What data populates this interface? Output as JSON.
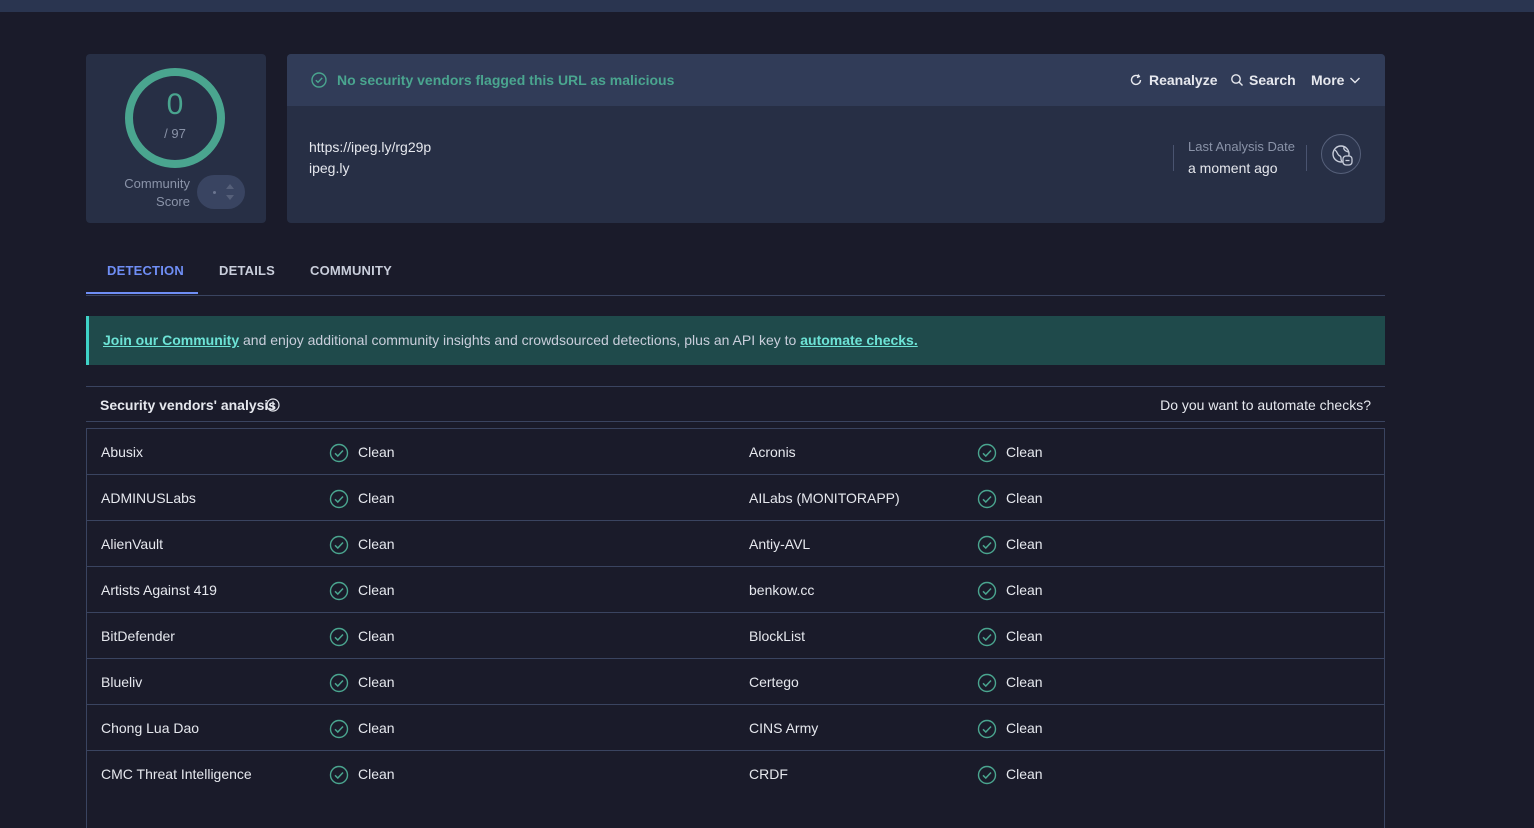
{
  "score": {
    "value": "0",
    "total": "/ 97",
    "community_label_1": "Community",
    "community_label_2": "Score"
  },
  "status": {
    "message": "No security vendors flagged this URL as malicious",
    "color": "#4aa58f"
  },
  "actions": {
    "reanalyze": "Reanalyze",
    "search": "Search",
    "more": "More"
  },
  "target": {
    "url": "https://ipeg.ly/rg29p",
    "domain": "ipeg.ly"
  },
  "analysis_date": {
    "label": "Last Analysis Date",
    "value": "a moment ago"
  },
  "tabs": [
    {
      "label": "DETECTION",
      "active": true
    },
    {
      "label": "DETAILS",
      "active": false
    },
    {
      "label": "COMMUNITY",
      "active": false
    }
  ],
  "banner": {
    "link1": "Join our Community",
    "middle": " and enjoy additional community insights and crowdsourced detections, plus an API key to ",
    "link2": "automate checks."
  },
  "analysis": {
    "title": "Security vendors' analysis",
    "automate_question": "Do you want to automate checks?"
  },
  "vendors": [
    {
      "left": "Abusix",
      "left_result": "Clean",
      "right": "Acronis",
      "right_result": "Clean"
    },
    {
      "left": "ADMINUSLabs",
      "left_result": "Clean",
      "right": "AILabs (MONITORAPP)",
      "right_result": "Clean"
    },
    {
      "left": "AlienVault",
      "left_result": "Clean",
      "right": "Antiy-AVL",
      "right_result": "Clean"
    },
    {
      "left": "Artists Against 419",
      "left_result": "Clean",
      "right": "benkow.cc",
      "right_result": "Clean"
    },
    {
      "left": "BitDefender",
      "left_result": "Clean",
      "right": "BlockList",
      "right_result": "Clean"
    },
    {
      "left": "Blueliv",
      "left_result": "Clean",
      "right": "Certego",
      "right_result": "Clean"
    },
    {
      "left": "Chong Lua Dao",
      "left_result": "Clean",
      "right": "CINS Army",
      "right_result": "Clean"
    },
    {
      "left": "CMC Threat Intelligence",
      "left_result": "Clean",
      "right": "CRDF",
      "right_result": "Clean"
    }
  ]
}
